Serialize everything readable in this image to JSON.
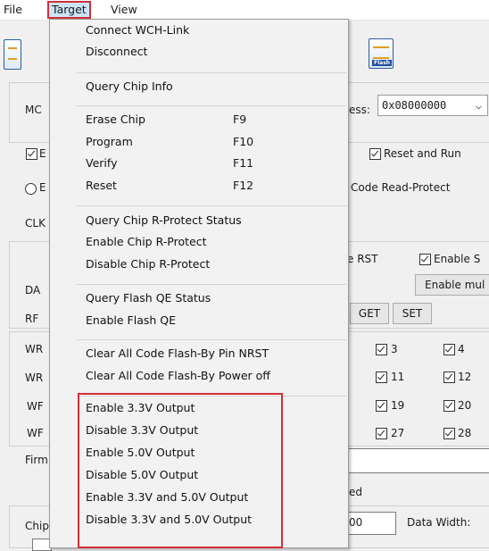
{
  "menubar": {
    "file": "File",
    "target": "Target",
    "view": "View"
  },
  "toolbar": {
    "flash_label": "Flash"
  },
  "background": {
    "mc_label": "MC",
    "address_label": "ess:",
    "address_value": "0x08000000",
    "cb_e_label": "E",
    "reset_run_label": "Reset and Run",
    "rb_e_label": "E",
    "code_protect_label": "Code Read-Protect",
    "clk_label": "CLK",
    "rst_label": "e RST",
    "enable_s_label": "Enable S",
    "enable_mul_label": "Enable mul",
    "da_label": "DA",
    "rf_label": "RF",
    "get_label": "GET",
    "set_label": "SET",
    "wr_labels": [
      "WR",
      "WR",
      "WF",
      "WF"
    ],
    "cb_grid": [
      [
        "3",
        "4"
      ],
      [
        "11",
        "12"
      ],
      [
        "19",
        "20"
      ],
      [
        "27",
        "28"
      ]
    ],
    "firm_label": "Firm",
    "ed_label": "ed",
    "chip_label": "Chip",
    "num_value": "00",
    "data_width_label": "Data Width:"
  },
  "dropdown": {
    "connect": "Connect  WCH-Link",
    "disconnect": "Disconnect",
    "query_chip_info": "Query Chip Info",
    "erase_chip": "Erase Chip",
    "erase_key": "F9",
    "program": "Program",
    "program_key": "F10",
    "verify": "Verify",
    "verify_key": "F11",
    "reset": "Reset",
    "reset_key": "F12",
    "query_rprotect": "Query Chip R-Protect Status",
    "enable_rprotect": "Enable Chip R-Protect",
    "disable_rprotect": "Disable Chip R-Protect",
    "query_qe": "Query Flash QE Status",
    "enable_qe": "Enable Flash QE",
    "clear_nrst": "Clear All Code Flash-By Pin NRST",
    "clear_power": "Clear All Code Flash-By Power off",
    "en33": "Enable 3.3V Output",
    "dis33": "Disable 3.3V Output",
    "en50": "Enable 5.0V Output",
    "dis50": "Disable 5.0V Output",
    "en_both": "Enable 3.3V and 5.0V Output",
    "dis_both": "Disable 3.3V and 5.0V Output"
  },
  "colors": {
    "highlight": "#d0303a",
    "menu_bg": "#f2f2f2",
    "selected": "#cde4f7"
  }
}
